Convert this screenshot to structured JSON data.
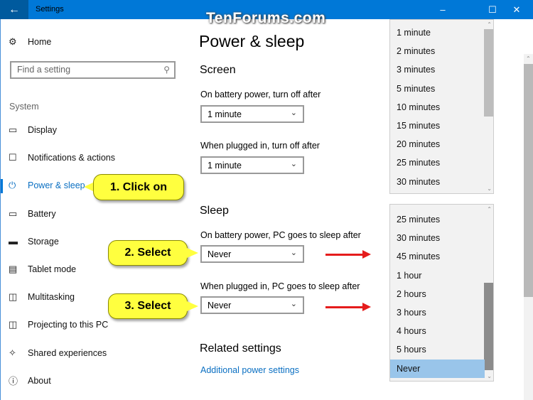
{
  "window": {
    "title": "Settings",
    "watermark": "TenForums.com",
    "accent": "#0078d7"
  },
  "sidebar": {
    "home": "Home",
    "search_placeholder": "Find a setting",
    "section": "System",
    "items": [
      {
        "label": "Display",
        "icon": "monitor-icon"
      },
      {
        "label": "Notifications & actions",
        "icon": "notification-icon"
      },
      {
        "label": "Power & sleep",
        "icon": "power-icon",
        "active": true
      },
      {
        "label": "Battery",
        "icon": "battery-icon"
      },
      {
        "label": "Storage",
        "icon": "storage-icon"
      },
      {
        "label": "Tablet mode",
        "icon": "tablet-mode-icon"
      },
      {
        "label": "Multitasking",
        "icon": "multitasking-icon"
      },
      {
        "label": "Projecting to this PC",
        "icon": "projecting-icon"
      },
      {
        "label": "Shared experiences",
        "icon": "shared-experiences-icon"
      },
      {
        "label": "About",
        "icon": "info-icon"
      }
    ]
  },
  "main": {
    "title": "Power & sleep",
    "screen": {
      "heading": "Screen",
      "battery_label": "On battery power, turn off after",
      "battery_value": "1 minute",
      "plugged_label": "When plugged in, turn off after",
      "plugged_value": "1 minute"
    },
    "sleep": {
      "heading": "Sleep",
      "battery_label": "On battery power, PC goes to sleep after",
      "battery_value": "Never",
      "plugged_label": "When plugged in, PC goes to sleep after",
      "plugged_value": "Never"
    },
    "related": {
      "heading": "Related settings",
      "link": "Additional power settings"
    }
  },
  "dropdown1": {
    "options": [
      "1 minute",
      "2 minutes",
      "3 minutes",
      "5 minutes",
      "10 minutes",
      "15 minutes",
      "20 minutes",
      "25 minutes",
      "30 minutes"
    ]
  },
  "dropdown2": {
    "options": [
      "25 minutes",
      "30 minutes",
      "45 minutes",
      "1 hour",
      "2 hours",
      "3 hours",
      "4 hours",
      "5 hours",
      "Never"
    ],
    "selected": "Never"
  },
  "callouts": [
    "1. Click on",
    "2. Select",
    "3. Select"
  ]
}
